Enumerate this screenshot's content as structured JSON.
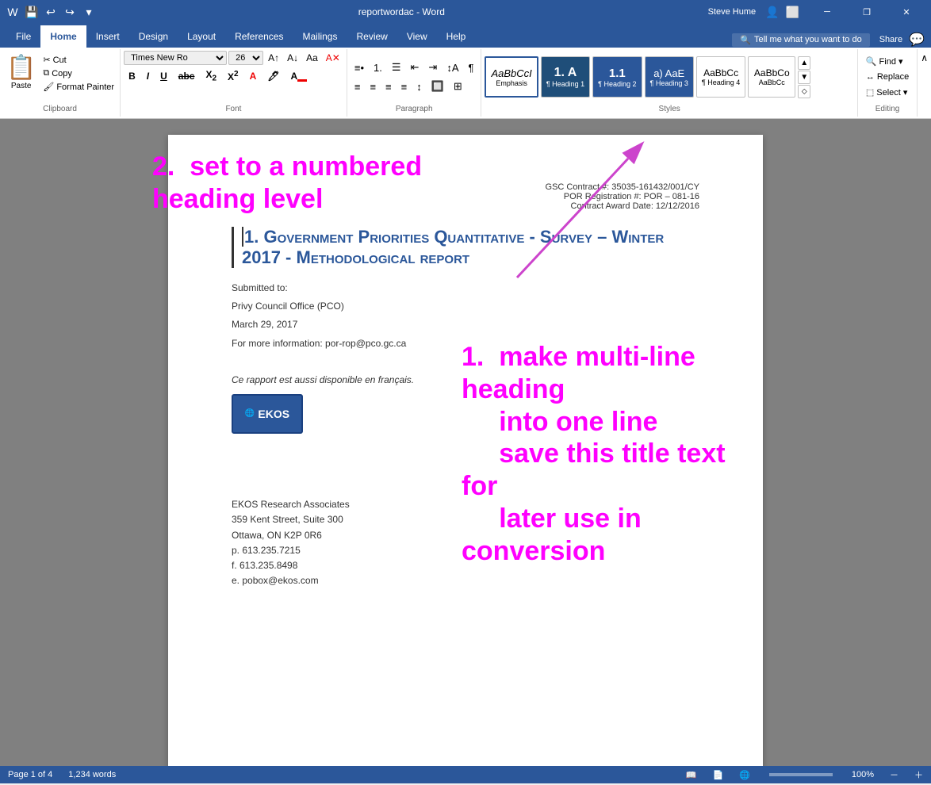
{
  "titlebar": {
    "title": "reportwordac - Word",
    "user": "Steve Hume",
    "save_icon": "💾",
    "undo_icon": "↩",
    "redo_icon": "↪",
    "minimize": "─",
    "restore": "❐",
    "close": "✕"
  },
  "ribbon": {
    "tabs": [
      "File",
      "Home",
      "Insert",
      "Design",
      "Layout",
      "References",
      "Mailings",
      "Review",
      "View",
      "Help"
    ],
    "active_tab": "Home",
    "tell_me": "Tell me what you want to do",
    "share": "Share",
    "clipboard": {
      "paste_label": "Paste",
      "cut_label": "Cut",
      "copy_label": "Copy",
      "format_painter_label": "Format Painter",
      "group_label": "Clipboard"
    },
    "font": {
      "face": "Times New Ro",
      "size": "26",
      "bold": "B",
      "italic": "I",
      "underline": "U",
      "strikethrough": "abc",
      "subscript": "X₂",
      "superscript": "X²",
      "group_label": "Font"
    },
    "paragraph": {
      "group_label": "Paragraph"
    },
    "styles": {
      "items": [
        {
          "label": "Emphasis",
          "name": "emphasis",
          "sample": "AaBbCcI"
        },
        {
          "label": "¶ Heading 1",
          "name": "heading1",
          "sample": "1. A"
        },
        {
          "label": "¶ Heading 2",
          "name": "heading2",
          "sample": "1.1"
        },
        {
          "label": "¶ Heading 3",
          "name": "heading3",
          "sample": "a) AaE"
        },
        {
          "label": "¶ Heading 4",
          "name": "heading4",
          "sample": "AaBbCc"
        },
        {
          "label": "AaBbCc",
          "name": "heading4b",
          "sample": "AaBbCo"
        }
      ],
      "group_label": "Styles"
    },
    "editing": {
      "find_label": "Find",
      "replace_label": "Replace",
      "select_label": "Select",
      "group_label": "Editing"
    }
  },
  "document": {
    "contract_line1": "GSC Contract #: 35035-161432/001/CY",
    "contract_line2": "POR Registration #: POR – 081-16",
    "contract_line3": "Contract Award Date: 12/12/2016",
    "heading": "1.   Government Priorities Quantitative - Survey – Winter 2017 - Methodological report",
    "submitted_to": "Submitted to:",
    "client": "Privy Council Office (PCO)",
    "date": "March 29, 2017",
    "info_line": "For more information: por-rop@pco.gc.ca",
    "french_note": "Ce rapport est aussi disponible en français.",
    "company": "EKOS Research Associates",
    "address1": "359 Kent Street, Suite 300",
    "address2": "Ottawa, ON      K2P 0R6",
    "phone": "p. 613.235.7215",
    "fax": "f. 613.235.8498",
    "email": "e. pobox@ekos.com",
    "logo_text": "EKOS"
  },
  "annotations": {
    "step2": "2.  set to a numbered\nheading level",
    "step1_line1": "1.  make multi-line heading",
    "step1_line2": "into one line",
    "step1_line3": "save this title text for",
    "step1_line4": "later use in conversion"
  },
  "statusbar": {
    "page_info": "Page 1 of 4",
    "word_count": "1,234 words"
  }
}
